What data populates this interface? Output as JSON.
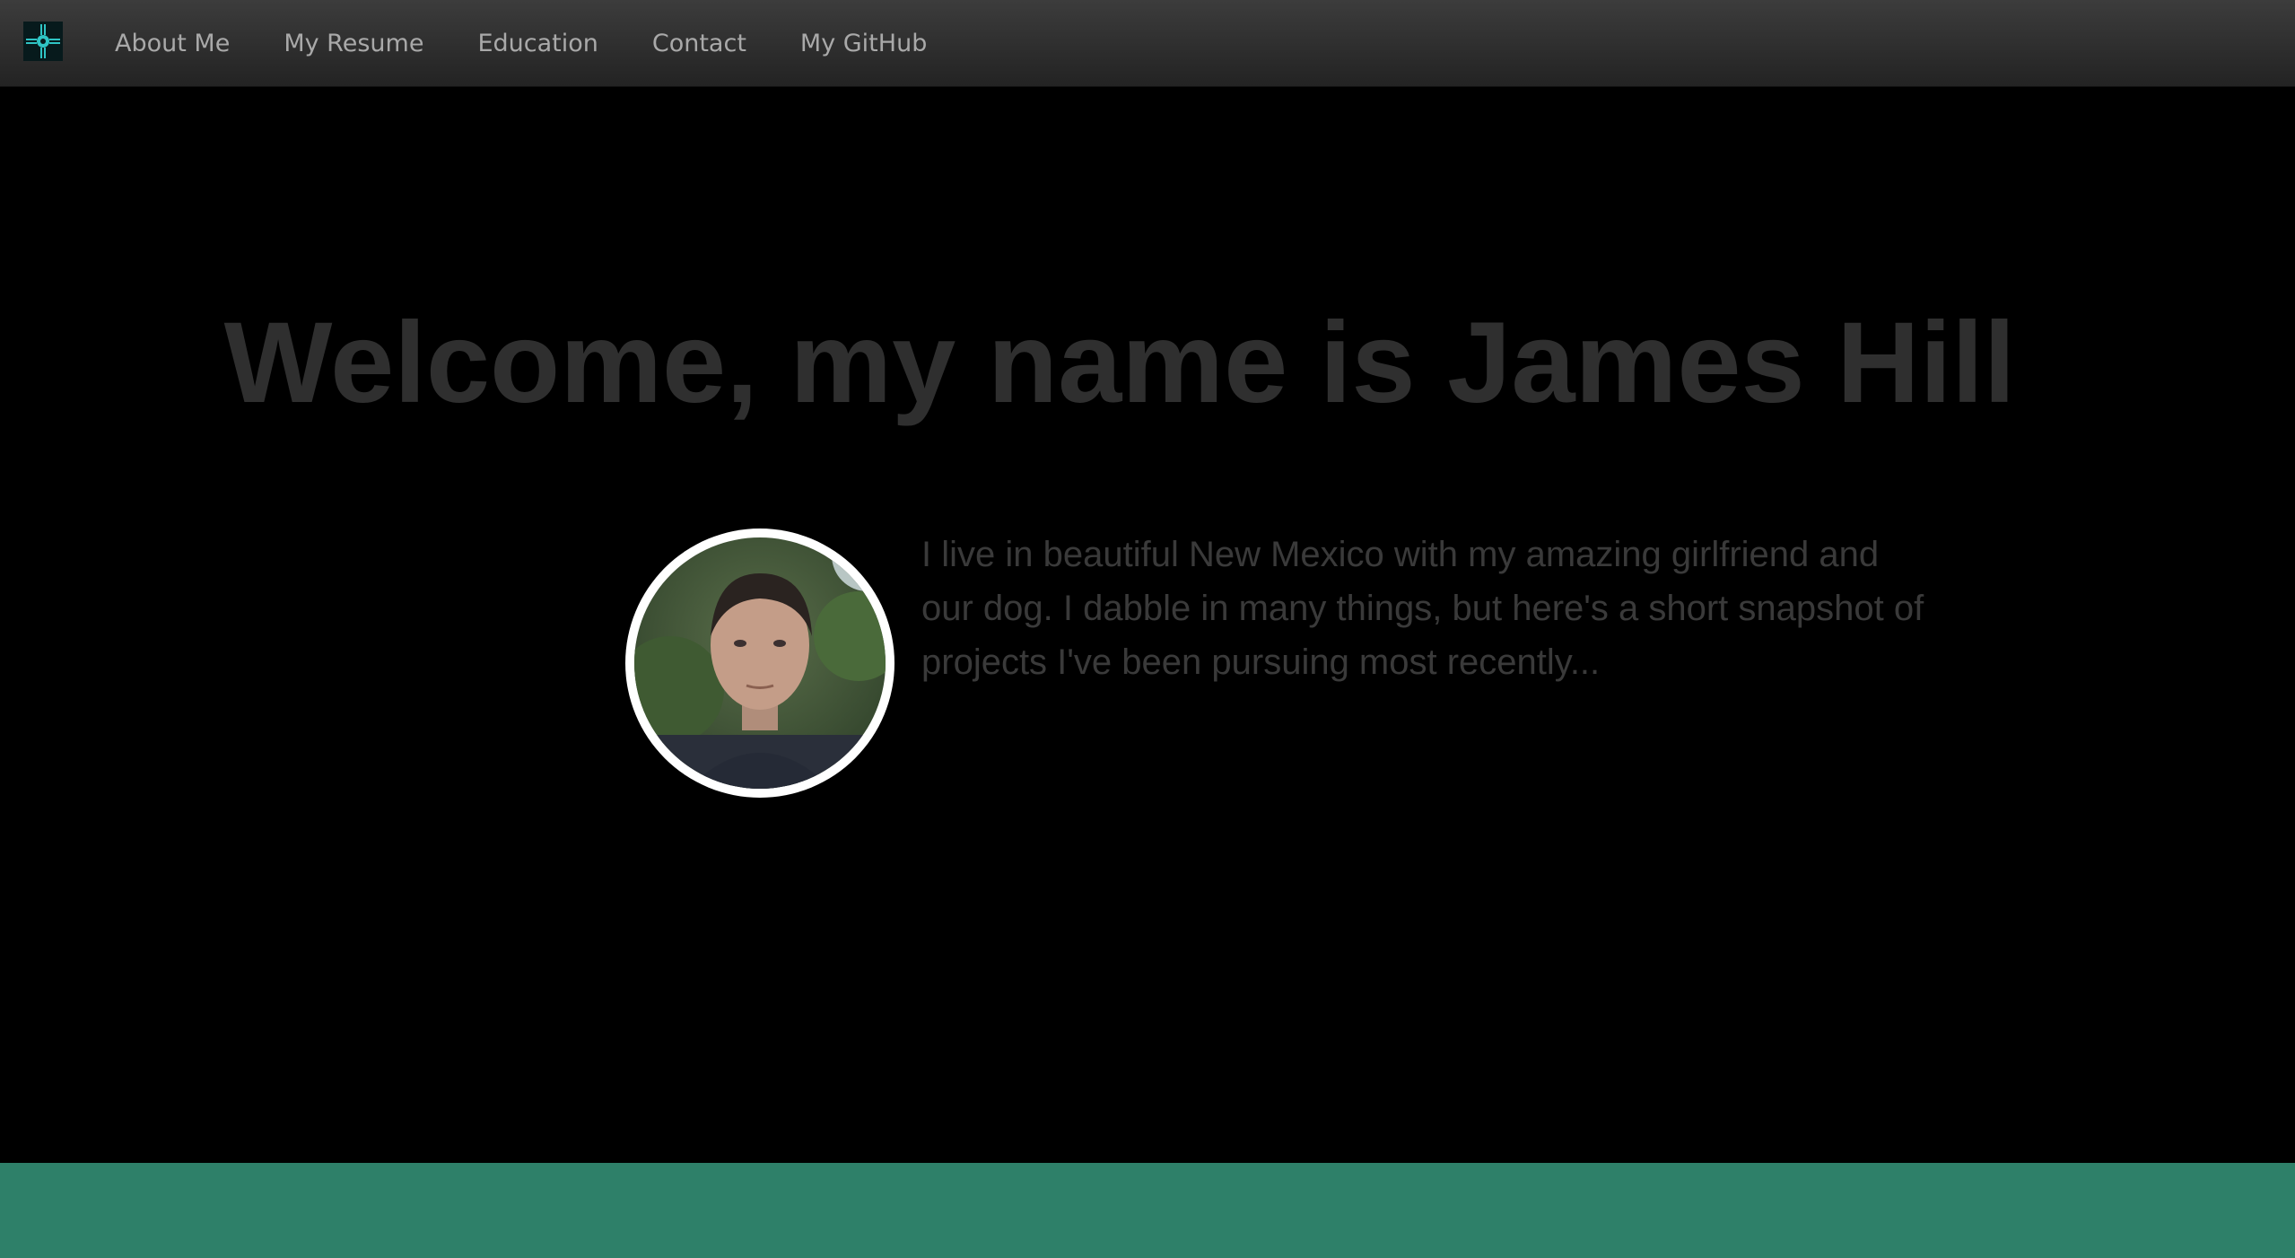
{
  "nav": {
    "logo_icon": "zia-sun-icon",
    "items": [
      {
        "label": "About Me"
      },
      {
        "label": "My Resume"
      },
      {
        "label": "Education"
      },
      {
        "label": "Contact"
      },
      {
        "label": "My GitHub"
      }
    ]
  },
  "hero": {
    "title": "Welcome, my name is James Hill",
    "intro": "I live in beautiful New Mexico with my amazing girlfriend and our dog. I dabble in many things, but here's a short snapshot of projects I've been pursuing most recently..."
  },
  "colors": {
    "background": "#000000",
    "accent": "#2e8069",
    "logo_accent": "#2fc4c4",
    "title_text": "#2f2f2f",
    "nav_text": "#a9a9a9"
  }
}
